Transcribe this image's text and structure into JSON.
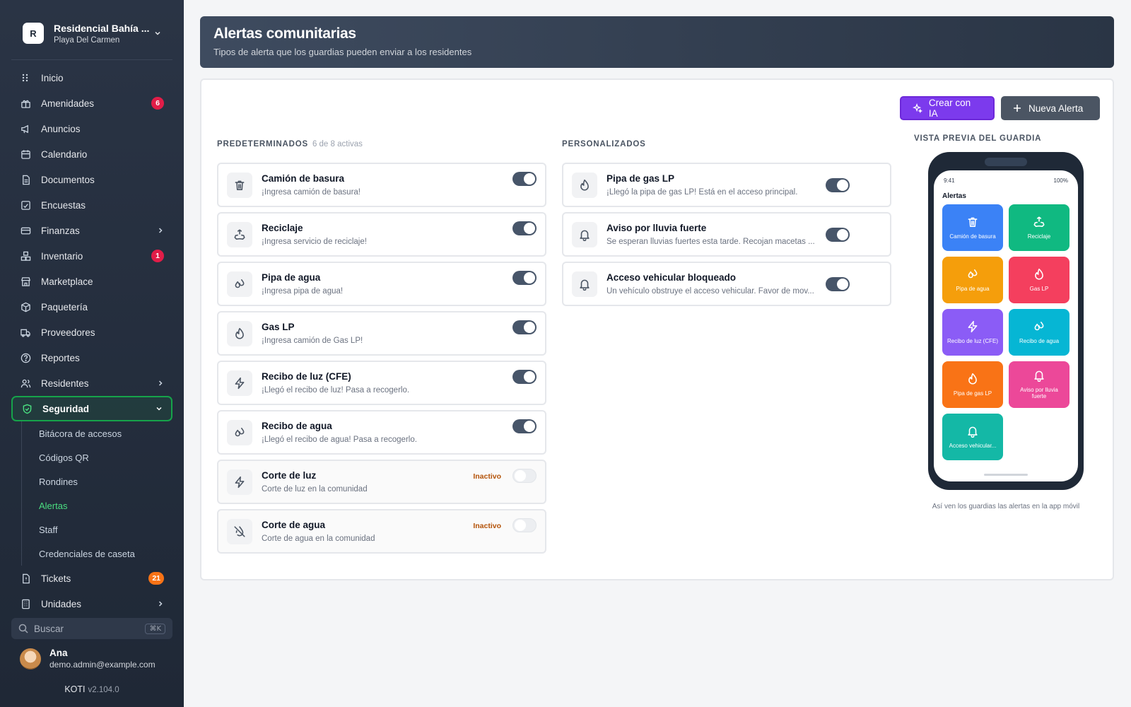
{
  "org": {
    "initial": "R",
    "name": "Residencial Bahía ...",
    "city": "Playa Del Carmen"
  },
  "nav": {
    "inicio": "Inicio",
    "amenidades": "Amenidades",
    "amenidades_badge": "6",
    "anuncios": "Anuncios",
    "calendario": "Calendario",
    "documentos": "Documentos",
    "encuestas": "Encuestas",
    "finanzas": "Finanzas",
    "inventario": "Inventario",
    "inventario_badge": "1",
    "marketplace": "Marketplace",
    "paqueteria": "Paquetería",
    "proveedores": "Proveedores",
    "reportes": "Reportes",
    "residentes": "Residentes",
    "seguridad": "Seguridad",
    "sub": [
      "Bitácora de accesos",
      "Códigos QR",
      "Rondines",
      "Alertas",
      "Staff",
      "Credenciales de caseta"
    ],
    "tickets": "Tickets",
    "tickets_badge": "21",
    "unidades": "Unidades"
  },
  "search": {
    "placeholder": "Buscar",
    "shortcut": "⌘K"
  },
  "user": {
    "name": "Ana",
    "email": "demo.admin@example.com"
  },
  "brand": {
    "name": "KOTI",
    "version": "v2.104.0"
  },
  "header": {
    "title": "Alertas comunitarias",
    "subtitle": "Tipos de alerta que los guardias pueden enviar a los residentes"
  },
  "actions": {
    "create_ai": "Crear con IA",
    "new_alert": "Nueva Alerta"
  },
  "predeterminados": {
    "title": "PREDETERMINADOS",
    "count": "6 de 8 activas",
    "items": [
      {
        "title": "Camión de basura",
        "desc": "¡Ingresa camión de basura!",
        "icon": "trash-icon",
        "active": true
      },
      {
        "title": "Reciclaje",
        "desc": "¡Ingresa servicio de reciclaje!",
        "icon": "recycle-icon",
        "active": true
      },
      {
        "title": "Pipa de agua",
        "desc": "¡Ingresa pipa de agua!",
        "icon": "droplets-icon",
        "active": true
      },
      {
        "title": "Gas LP",
        "desc": "¡Ingresa camión de Gas LP!",
        "icon": "flame-icon",
        "active": true
      },
      {
        "title": "Recibo de luz (CFE)",
        "desc": "¡Llegó el recibo de luz! Pasa a recogerlo.",
        "icon": "bolt-icon",
        "active": true
      },
      {
        "title": "Recibo de agua",
        "desc": "¡Llegó el recibo de agua! Pasa a recogerlo.",
        "icon": "droplets-icon",
        "active": true
      },
      {
        "title": "Corte de luz",
        "desc": "Corte de luz en la comunidad",
        "icon": "bolt-icon",
        "active": false,
        "tag": "Inactivo"
      },
      {
        "title": "Corte de agua",
        "desc": "Corte de agua en la comunidad",
        "icon": "droplet-off-icon",
        "active": false,
        "tag": "Inactivo"
      }
    ]
  },
  "personalizados": {
    "title": "PERSONALIZADOS",
    "items": [
      {
        "title": "Pipa de gas LP",
        "desc": "¡Llegó la pipa de gas LP! Está en el acceso principal.",
        "icon": "flame-icon",
        "active": true
      },
      {
        "title": "Aviso por lluvia fuerte",
        "desc": "Se esperan lluvias fuertes esta tarde. Recojan macetas ...",
        "icon": "bell-icon",
        "active": true
      },
      {
        "title": "Acceso vehicular bloqueado",
        "desc": "Un vehículo obstruye el acceso vehicular. Favor de mov...",
        "icon": "bell-icon",
        "active": true
      }
    ]
  },
  "preview": {
    "title": "VISTA PREVIA DEL GUARDIA",
    "time": "9:41",
    "battery": "100%",
    "screen_title": "Alertas",
    "caption": "Así ven los guardias las alertas en la app móvil",
    "tiles": [
      {
        "label": "Camión de basura",
        "color": "#3b82f6",
        "icon": "trash-icon"
      },
      {
        "label": "Reciclaje",
        "color": "#10b981",
        "icon": "recycle-icon"
      },
      {
        "label": "Pipa de agua",
        "color": "#f59e0b",
        "icon": "droplets-icon"
      },
      {
        "label": "Gas LP",
        "color": "#f43f5e",
        "icon": "flame-icon"
      },
      {
        "label": "Recibo de luz (CFE)",
        "color": "#8b5cf6",
        "icon": "bolt-icon"
      },
      {
        "label": "Recibo de agua",
        "color": "#06b6d4",
        "icon": "droplets-icon"
      },
      {
        "label": "Pipa de gas LP",
        "color": "#f97316",
        "icon": "flame-icon"
      },
      {
        "label": "Aviso por lluvia fuerte",
        "color": "#ec4899",
        "icon": "bell-icon"
      },
      {
        "label": "Acceso vehicular...",
        "color": "#14b8a6",
        "icon": "bell-icon"
      }
    ]
  }
}
